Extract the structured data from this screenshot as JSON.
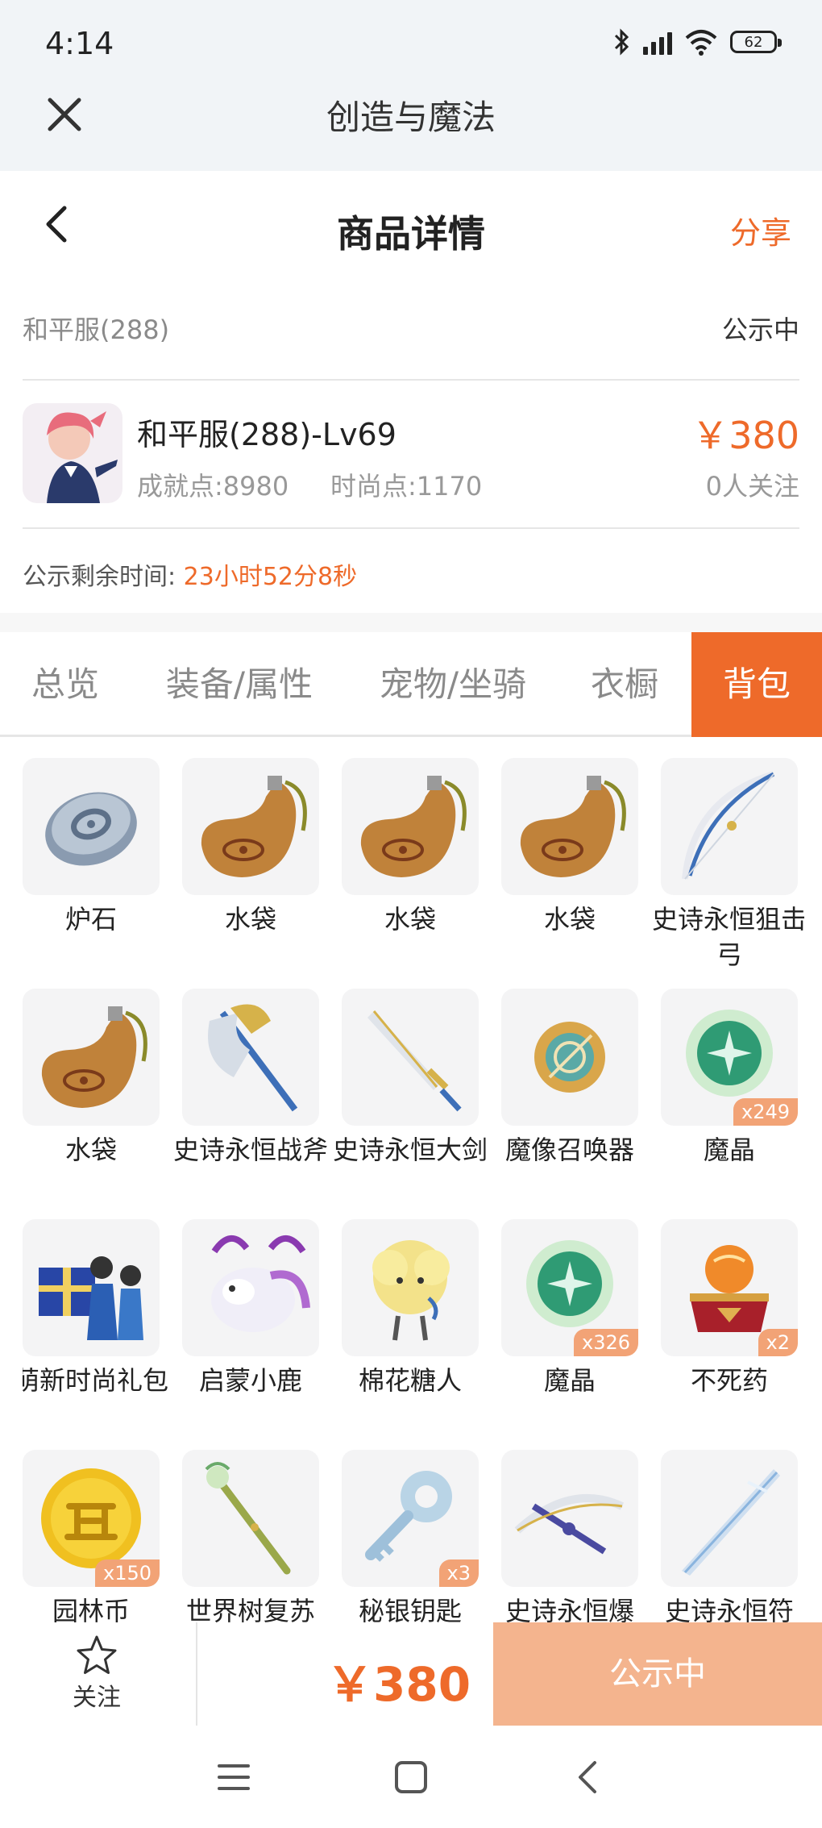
{
  "status_bar": {
    "time": "4:14",
    "battery": "62"
  },
  "app_header": {
    "title": "创造与魔法"
  },
  "page_header": {
    "title": "商品详情",
    "share_label": "分享"
  },
  "server": {
    "name": "和平服(288)",
    "status": "公示中"
  },
  "product": {
    "name": "和平服(288)-Lv69",
    "achievement": "成就点:8980",
    "fashion": "时尚点:1170",
    "price": "￥380",
    "followers": "0人关注"
  },
  "remaining": {
    "label": "公示剩余时间:",
    "value": "23小时52分8秒"
  },
  "tabs": [
    {
      "label": "总览"
    },
    {
      "label": "装备/属性"
    },
    {
      "label": "宠物/坐骑"
    },
    {
      "label": "衣橱"
    },
    {
      "label": "背包"
    }
  ],
  "active_tab": "背包",
  "items": [
    {
      "name": "炉石",
      "icon": "stone-icon",
      "qty": ""
    },
    {
      "name": "水袋",
      "icon": "waterskin-icon",
      "qty": ""
    },
    {
      "name": "水袋",
      "icon": "waterskin-icon",
      "qty": ""
    },
    {
      "name": "水袋",
      "icon": "waterskin-icon",
      "qty": ""
    },
    {
      "name": "史诗永恒狙击弓",
      "icon": "bow-icon",
      "qty": ""
    },
    {
      "name": "水袋",
      "icon": "waterskin-icon",
      "qty": ""
    },
    {
      "name": "史诗永恒战斧",
      "icon": "axe-icon",
      "qty": ""
    },
    {
      "name": "史诗永恒大剑",
      "icon": "sword-icon",
      "qty": ""
    },
    {
      "name": "魔像召唤器",
      "icon": "summoner-icon",
      "qty": ""
    },
    {
      "name": "魔晶",
      "icon": "crystal-icon",
      "qty": "x249"
    },
    {
      "name": "萌新时尚礼包",
      "icon": "gift-pack-icon",
      "qty": ""
    },
    {
      "name": "启蒙小鹿",
      "icon": "deer-icon",
      "qty": ""
    },
    {
      "name": "棉花糖人",
      "icon": "cotton-candy-icon",
      "qty": ""
    },
    {
      "name": "魔晶",
      "icon": "crystal-icon",
      "qty": "x326"
    },
    {
      "name": "不死药",
      "icon": "elixir-icon",
      "qty": "x2"
    },
    {
      "name": "园林币",
      "icon": "coin-icon",
      "qty": "x150"
    },
    {
      "name": "世界树复苏",
      "icon": "staff-icon",
      "qty": ""
    },
    {
      "name": "秘银钥匙",
      "icon": "key-icon",
      "qty": "x3"
    },
    {
      "name": "史诗永恒爆",
      "icon": "crossbow-icon",
      "qty": ""
    },
    {
      "name": "史诗永恒符",
      "icon": "blade-icon",
      "qty": ""
    }
  ],
  "bottom_bar": {
    "follow_label": "关注",
    "price": "￥380",
    "action_label": "公示中"
  },
  "colors": {
    "accent": "#ee6a2a",
    "accent_light": "#f4b48e",
    "badge": "#f2a376"
  }
}
